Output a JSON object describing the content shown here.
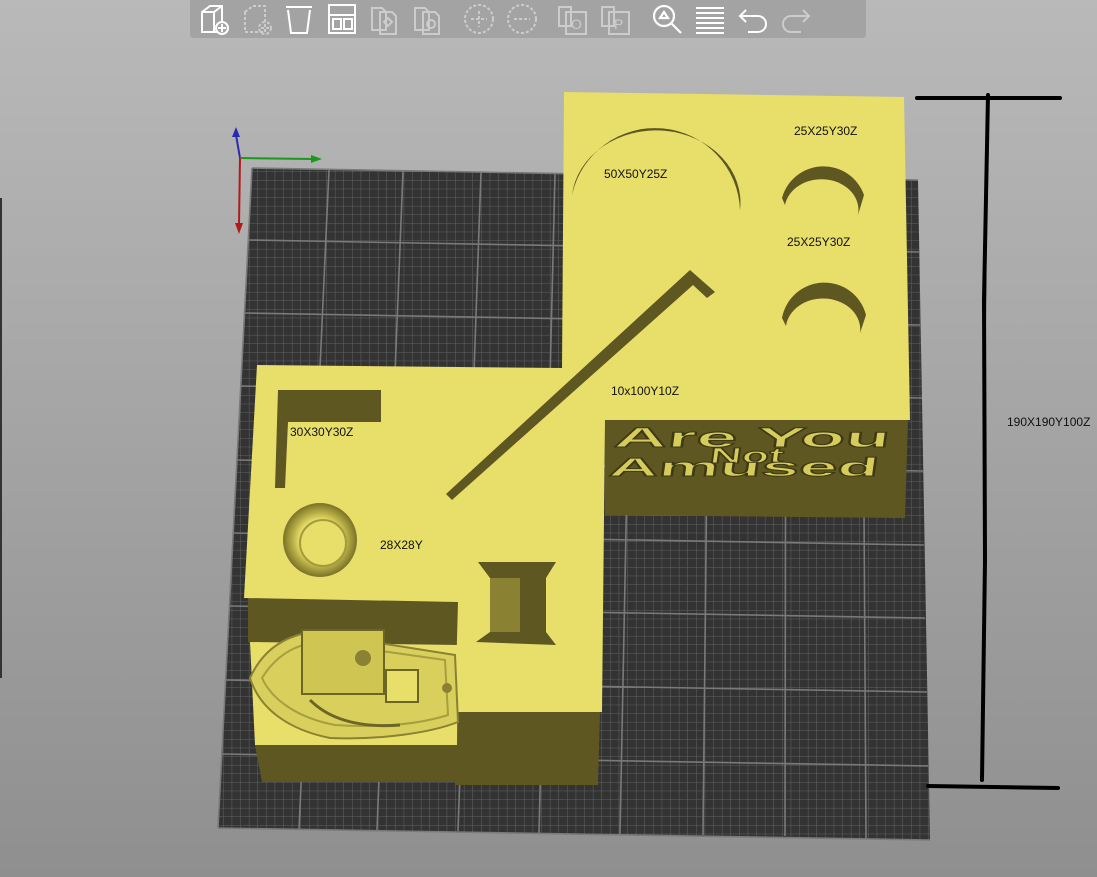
{
  "toolbar": {
    "buttons": [
      {
        "name": "add-model-button",
        "icon": "add-model-icon",
        "enabled": true
      },
      {
        "name": "remove-model-button",
        "icon": "remove-model-icon",
        "enabled": false
      },
      {
        "name": "delete-all-button",
        "icon": "trash-icon",
        "enabled": true
      },
      {
        "name": "arrange-button",
        "icon": "arrange-icon",
        "enabled": true
      },
      {
        "name": "copy-button",
        "icon": "copy-icon",
        "enabled": false
      },
      {
        "name": "paste-button",
        "icon": "paste-icon",
        "enabled": false
      },
      {
        "name": "add-instance-button",
        "icon": "plus-circle-icon",
        "enabled": false
      },
      {
        "name": "remove-instance-button",
        "icon": "minus-circle-icon",
        "enabled": false
      },
      {
        "name": "split-objects-button",
        "icon": "split-objects-icon",
        "enabled": false
      },
      {
        "name": "split-parts-button",
        "icon": "split-parts-icon",
        "enabled": false
      },
      {
        "name": "search-button",
        "icon": "search-icon",
        "enabled": true
      },
      {
        "name": "layers-button",
        "icon": "layers-icon",
        "enabled": true
      },
      {
        "name": "undo-button",
        "icon": "undo-icon",
        "enabled": true
      },
      {
        "name": "redo-button",
        "icon": "redo-icon",
        "enabled": false
      }
    ]
  },
  "scene": {
    "labels": {
      "hole_large": "50X50Y25Z",
      "hole_small_top": "25X25Y30Z",
      "hole_small_bottom": "25X25Y30Z",
      "slot": "10x100Y10Z",
      "square_pocket": "30X30Y30Z",
      "ring": "28X28Y",
      "overall": "190X190Y100Z"
    },
    "engraved_text": [
      "Are You",
      "Not",
      "Amused"
    ],
    "colors": {
      "model": "#e8de6a",
      "model_side": "#6d6524",
      "bed_grid": "#333333",
      "bed_line": "#5a5a5a"
    },
    "axis_icons": [
      "z-axis-icon",
      "y-axis-icon",
      "x-axis-icon"
    ]
  }
}
